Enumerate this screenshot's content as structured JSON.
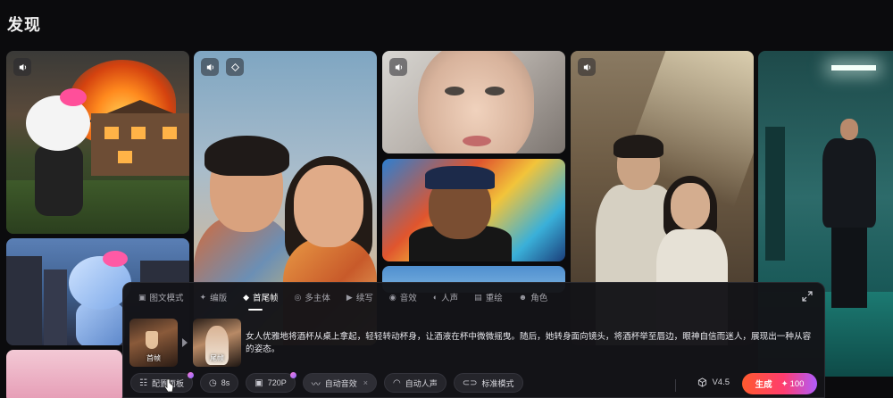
{
  "page": {
    "title": "发现"
  },
  "panel": {
    "tabs": [
      {
        "label": "图文模式",
        "icon": "image-text-icon"
      },
      {
        "label": "编版",
        "icon": "sparkle-icon"
      },
      {
        "label": "首尾帧",
        "icon": "diamond-icon",
        "active": true
      },
      {
        "label": "多主体",
        "icon": "multi-subject-icon"
      },
      {
        "label": "续写",
        "icon": "continue-icon"
      },
      {
        "label": "音效",
        "icon": "sound-effect-icon"
      },
      {
        "label": "人声",
        "icon": "voice-icon"
      },
      {
        "label": "重绘",
        "icon": "redraw-icon"
      },
      {
        "label": "角色",
        "icon": "character-icon"
      }
    ],
    "frames": {
      "first_label": "首帧",
      "tail_label": "尾帧"
    },
    "prompt": "女人优雅地将酒杯从桌上拿起，轻轻转动杯身，让酒液在杯中微微摇曳。随后，她转身面向镜头，将酒杯举至唇边，眼神自信而迷人，展现出一种从容的姿态。",
    "toolbar": {
      "config_panel": "配置面板",
      "duration": "8s",
      "resolution": "720P",
      "auto_sfx": "自动音效",
      "auto_voice": "自动人声",
      "standard_mode": "标准模式"
    },
    "model_version": "V4.5",
    "generate": {
      "label": "生成",
      "cost": "100"
    }
  },
  "colors": {
    "accent_start": "#ff5a2e",
    "accent_end": "#b05cff",
    "background": "#0b0b0d"
  }
}
